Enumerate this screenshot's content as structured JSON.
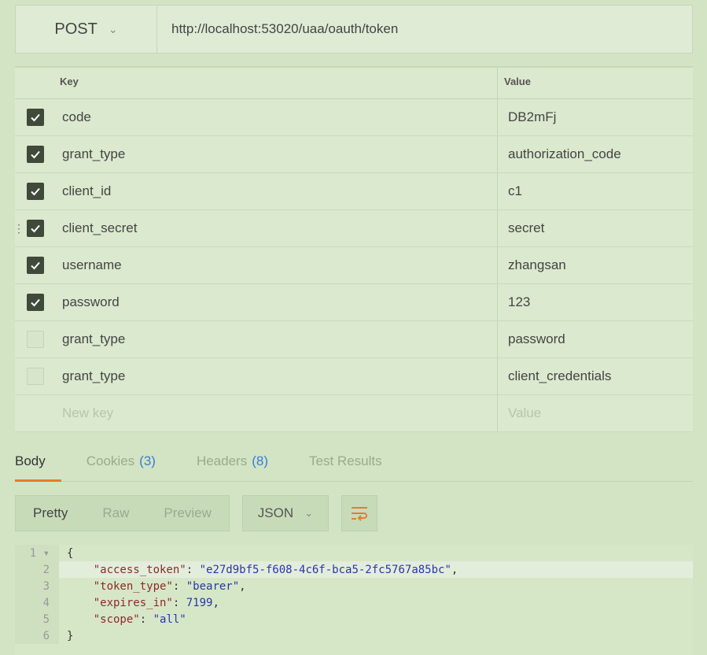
{
  "request": {
    "method": "POST",
    "url": "http://localhost:53020/uaa/oauth/token"
  },
  "params": {
    "key_header": "Key",
    "value_header": "Value",
    "rows": [
      {
        "key": "code",
        "value": "DB2mFj",
        "checked": true
      },
      {
        "key": "grant_type",
        "value": "authorization_code",
        "checked": true
      },
      {
        "key": "client_id",
        "value": "c1",
        "checked": true
      },
      {
        "key": "client_secret",
        "value": "secret",
        "checked": true
      },
      {
        "key": "username",
        "value": "zhangsan",
        "checked": true
      },
      {
        "key": "password",
        "value": "123",
        "checked": true
      },
      {
        "key": "grant_type",
        "value": "password",
        "checked": false
      },
      {
        "key": "grant_type",
        "value": "client_credentials",
        "checked": false
      }
    ],
    "new_key_placeholder": "New key",
    "new_value_placeholder": "Value"
  },
  "response_tabs": {
    "body": "Body",
    "cookies": "Cookies",
    "cookies_count": "(3)",
    "headers": "Headers",
    "headers_count": "(8)",
    "tests": "Test Results"
  },
  "toolbar": {
    "pretty": "Pretty",
    "raw": "Raw",
    "preview": "Preview",
    "format": "JSON"
  },
  "code": {
    "line_numbers": [
      "1",
      "2",
      "3",
      "4",
      "5",
      "6"
    ],
    "open_brace": "{",
    "close_brace": "}",
    "access_token_key": "\"access_token\"",
    "access_token_value": "\"e27d9bf5-f608-4c6f-bca5-2fc5767a85bc\"",
    "token_type_key": "\"token_type\"",
    "token_type_value": "\"bearer\"",
    "expires_in_key": "\"expires_in\"",
    "expires_in_value": "7199",
    "scope_key": "\"scope\"",
    "scope_value": "\"all\""
  },
  "colors": {
    "accent": "#e67d27",
    "count": "#3a7bd5"
  }
}
